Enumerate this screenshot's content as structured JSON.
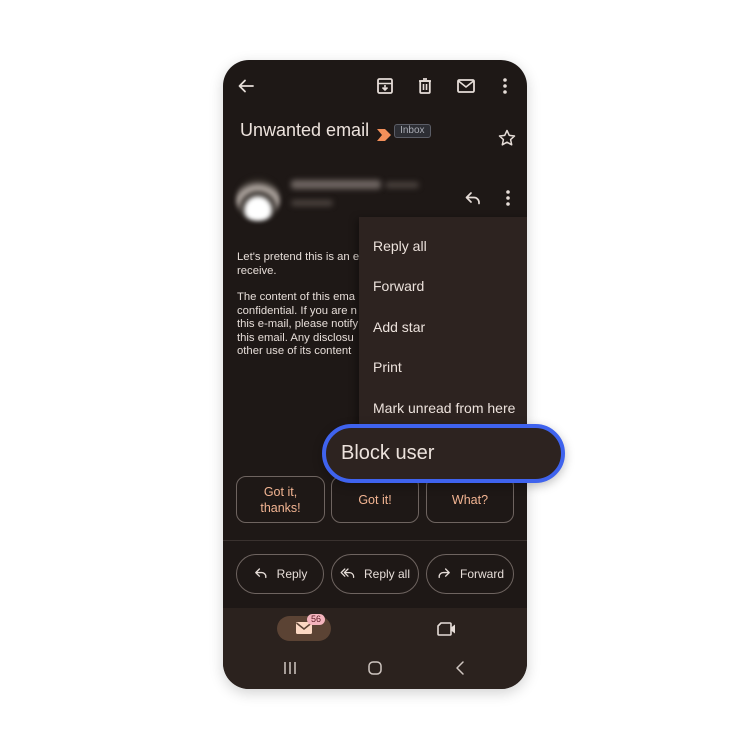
{
  "toolbar": {
    "back_icon": "arrow-left-icon",
    "archive_icon": "archive-icon",
    "delete_icon": "trash-icon",
    "mark_unread_icon": "mail-icon",
    "more_icon": "more-vert-icon"
  },
  "email": {
    "subject": "Unwanted email",
    "label": "Inbox",
    "important_marker_color": "#f28f5a",
    "star_icon": "star-outline-icon",
    "body_paragraphs": [
      "Let's pretend this is an e\nreceive.",
      "The content of this ema\nconfidential. If you are n\nthis e-mail, please notify\nthis email. Any disclosu\nother use of its content"
    ]
  },
  "sender": {
    "reply_icon": "reply-icon",
    "more_icon": "more-vert-icon"
  },
  "menu": {
    "items": [
      {
        "label": "Reply all"
      },
      {
        "label": "Forward"
      },
      {
        "label": "Add star"
      },
      {
        "label": "Print"
      },
      {
        "label": "Mark unread from here"
      },
      {
        "label": "Block user"
      }
    ],
    "highlight_color": "#3f63ee"
  },
  "smart_replies": [
    {
      "label": "Got it,\nthanks!"
    },
    {
      "label": "Got it!"
    },
    {
      "label": "What?"
    }
  ],
  "actions": [
    {
      "label": "Reply",
      "icon": "reply-icon"
    },
    {
      "label": "Reply all",
      "icon": "reply-all-icon"
    },
    {
      "label": "Forward",
      "icon": "forward-icon"
    }
  ],
  "bottom_nav": {
    "mail_badge": "56",
    "mail_icon": "mail-icon",
    "meet_icon": "video-camera-icon"
  },
  "system_nav": {
    "recents_icon": "recents-icon",
    "home_icon": "home-icon",
    "back_icon": "back-chevron-icon"
  }
}
